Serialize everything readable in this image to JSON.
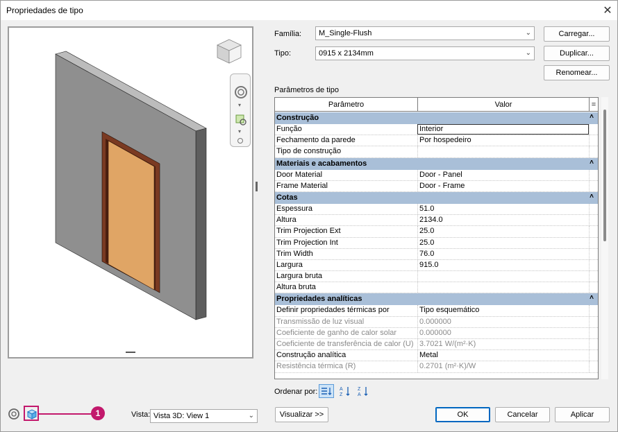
{
  "window": {
    "title": "Propriedades de tipo",
    "close_icon": "close-icon"
  },
  "family": {
    "label": "Família:",
    "value": "M_Single-Flush"
  },
  "type": {
    "label": "Tipo:",
    "value": "0915 x 2134mm"
  },
  "buttons": {
    "load": "Carregar...",
    "duplicate": "Duplicar...",
    "rename": "Renomear...",
    "preview": "Visualizar >>",
    "ok": "OK",
    "cancel": "Cancelar",
    "apply": "Aplicar"
  },
  "params_title": "Parâmetros de tipo",
  "table": {
    "headers": {
      "param": "Parâmetro",
      "value": "Valor",
      "eq": "="
    },
    "rows": [
      {
        "kind": "group",
        "name": "Construção"
      },
      {
        "kind": "row",
        "name": "Função",
        "value": "Interior",
        "selected": true
      },
      {
        "kind": "row",
        "name": "Fechamento da parede",
        "value": "Por hospedeiro"
      },
      {
        "kind": "row",
        "name": "Tipo de construção",
        "value": ""
      },
      {
        "kind": "group",
        "name": "Materiais e acabamentos"
      },
      {
        "kind": "row",
        "name": "Door Material",
        "value": "Door - Panel"
      },
      {
        "kind": "row",
        "name": "Frame Material",
        "value": "Door - Frame"
      },
      {
        "kind": "group",
        "name": "Cotas"
      },
      {
        "kind": "row",
        "name": "Espessura",
        "value": "51.0"
      },
      {
        "kind": "row",
        "name": "Altura",
        "value": "2134.0"
      },
      {
        "kind": "row",
        "name": "Trim Projection Ext",
        "value": "25.0"
      },
      {
        "kind": "row",
        "name": "Trim Projection Int",
        "value": "25.0"
      },
      {
        "kind": "row",
        "name": "Trim Width",
        "value": "76.0"
      },
      {
        "kind": "row",
        "name": "Largura",
        "value": "915.0"
      },
      {
        "kind": "row",
        "name": "Largura bruta",
        "value": ""
      },
      {
        "kind": "row",
        "name": "Altura bruta",
        "value": ""
      },
      {
        "kind": "group",
        "name": "Propriedades analíticas"
      },
      {
        "kind": "row",
        "name": "Definir propriedades térmicas por",
        "value": "Tipo esquemático"
      },
      {
        "kind": "row",
        "name": "Transmissão de luz visual",
        "value": "0.000000",
        "greyed": true
      },
      {
        "kind": "row",
        "name": "Coeficiente de ganho de calor solar",
        "value": "0.000000",
        "greyed": true
      },
      {
        "kind": "row",
        "name": "Coeficiente de transferência de calor (U)",
        "value": "3.7021 W/(m²·K)",
        "greyed": true
      },
      {
        "kind": "row",
        "name": "Construção analítica",
        "value": "Metal"
      },
      {
        "kind": "row",
        "name": "Resistência térmica (R)",
        "value": "0.2701 (m²·K)/W",
        "greyed": true
      }
    ]
  },
  "sort": {
    "label": "Ordenar por:"
  },
  "view": {
    "label": "Vista:",
    "value": "Vista 3D: View 1"
  },
  "callout": {
    "number": "1"
  },
  "colors": {
    "group_bg": "#a9bfd8",
    "door_panel": "#e0a565",
    "door_frame": "#7a3a22",
    "wall_front": "#8f8f8f",
    "callout": "#c2186c"
  }
}
